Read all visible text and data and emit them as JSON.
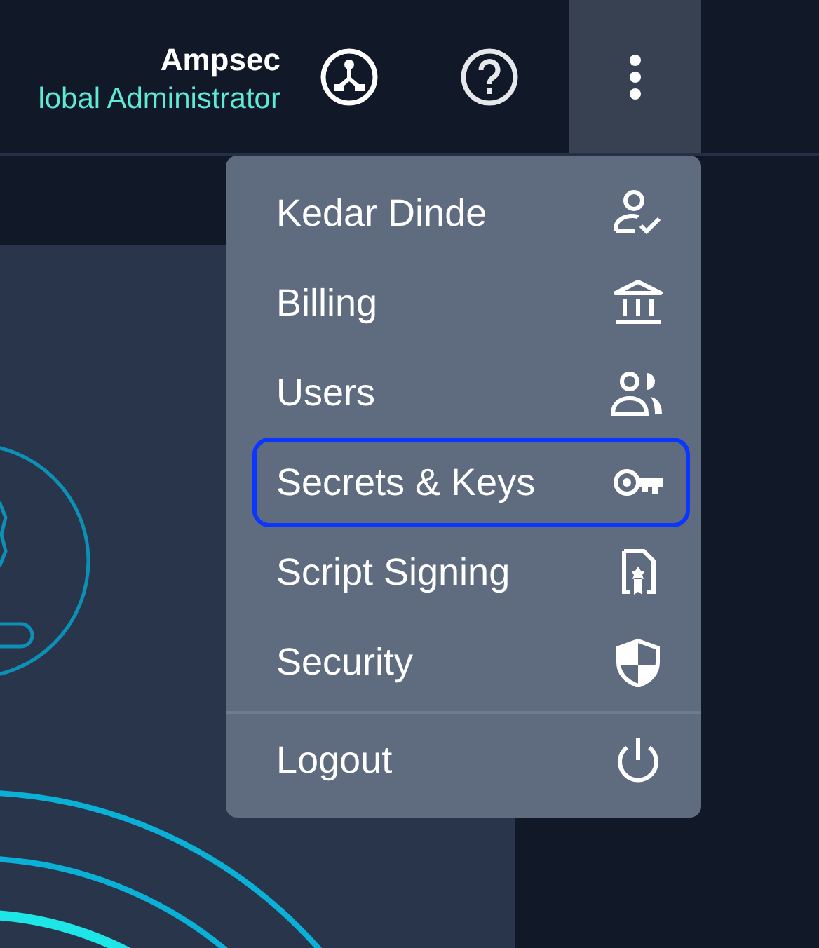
{
  "header": {
    "org_name": "Ampsec",
    "role": "lobal Administrator"
  },
  "menu": {
    "items": [
      {
        "label": "Kedar Dinde",
        "focused": false
      },
      {
        "label": "Billing",
        "focused": false
      },
      {
        "label": "Users",
        "focused": false
      },
      {
        "label": "Secrets & Keys",
        "focused": true
      },
      {
        "label": "Script Signing",
        "focused": false
      },
      {
        "label": "Security",
        "focused": false
      }
    ],
    "footer_item": {
      "label": "Logout",
      "focused": false
    }
  }
}
